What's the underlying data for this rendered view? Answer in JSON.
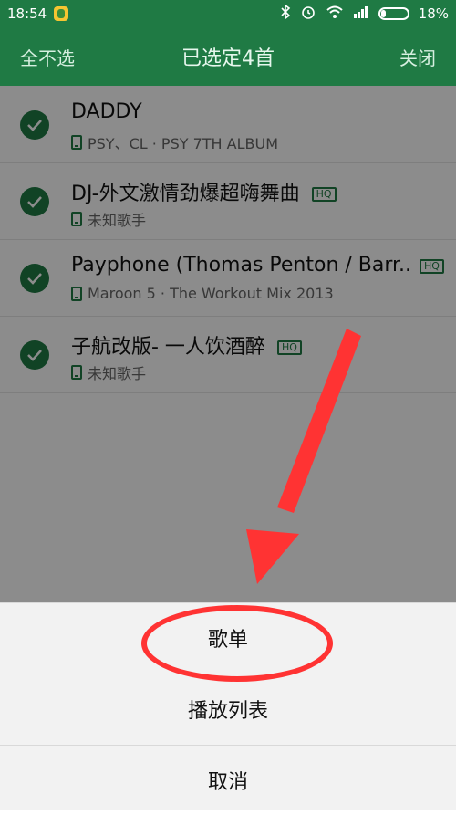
{
  "status_bar": {
    "time": "18:54",
    "battery_percent": "18%",
    "battery_level": 0.18
  },
  "header": {
    "left_action": "全不选",
    "title": "已选定4首",
    "right_action": "关闭"
  },
  "songs": [
    {
      "title": "DADDY",
      "subtitle": "PSY、CL · PSY 7TH ALBUM",
      "hq": ""
    },
    {
      "title": "DJ-外文激情劲爆超嗨舞曲",
      "subtitle": "未知歌手",
      "hq": "HQ"
    },
    {
      "title": "Payphone (Thomas Penton / Barr...",
      "subtitle": "Maroon 5 · The Workout Mix 2013",
      "hq": "HQ"
    },
    {
      "title": "子航改版- 一人饮酒醉",
      "subtitle": "未知歌手",
      "hq": "HQ"
    }
  ],
  "sheet": {
    "option1": "歌单",
    "option2": "播放列表",
    "cancel": "取消"
  },
  "colors": {
    "brand_green": "#1f7a44",
    "annotation_red": "#ff3333"
  }
}
